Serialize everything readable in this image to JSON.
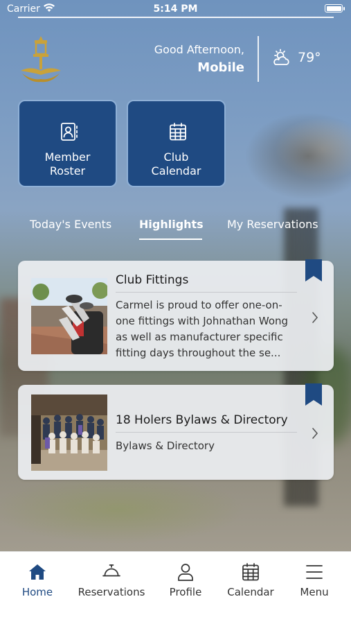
{
  "status_bar": {
    "carrier": "Carrier",
    "time": "5:14 PM"
  },
  "header": {
    "greeting": "Good Afternoon,",
    "name": "Mobile",
    "temperature": "79°",
    "weather_icon": "partly-cloudy-icon"
  },
  "tiles": [
    {
      "label_line1": "Member",
      "label_line2": "Roster",
      "icon": "member-roster-icon"
    },
    {
      "label_line1": "Club",
      "label_line2": "Calendar",
      "icon": "calendar-icon"
    }
  ],
  "tabs": [
    {
      "label": "Today's Events",
      "active": false
    },
    {
      "label": "Highlights",
      "active": true
    },
    {
      "label": "My Reservations",
      "active": false
    }
  ],
  "cards": [
    {
      "title": "Club Fittings",
      "body": "Carmel is proud to offer one-on-one fittings with Johnathan Wong as well as manufacturer specific fitting days throughout the se...",
      "image": "golf clubs in bag"
    },
    {
      "title": "18 Holers Bylaws & Directory",
      "body": "Bylaws & Directory",
      "image": "group photo of golfers"
    }
  ],
  "bottom_nav": [
    {
      "label": "Home",
      "icon": "home-icon",
      "active": true
    },
    {
      "label": "Reservations",
      "icon": "bell-icon",
      "active": false
    },
    {
      "label": "Profile",
      "icon": "person-icon",
      "active": false
    },
    {
      "label": "Calendar",
      "icon": "calendar-icon",
      "active": false
    },
    {
      "label": "Menu",
      "icon": "hamburger-menu-icon",
      "active": false
    }
  ],
  "colors": {
    "brand_blue": "#1f4a82",
    "tile_border": "#8fb0d6",
    "card_bg": "#eceef1"
  }
}
